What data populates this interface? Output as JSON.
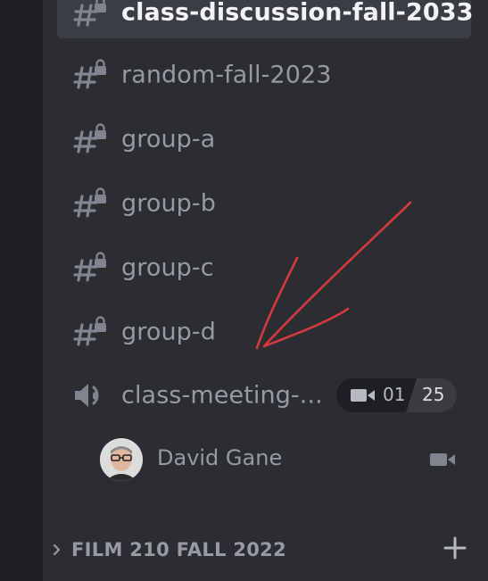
{
  "channels": [
    {
      "label": "class-discussion-fall-2033",
      "icon": "locked-text-channel-icon",
      "selected": true
    },
    {
      "label": "random-fall-2023",
      "icon": "locked-text-channel-icon",
      "selected": false
    },
    {
      "label": "group-a",
      "icon": "locked-text-channel-icon",
      "selected": false
    },
    {
      "label": "group-b",
      "icon": "locked-text-channel-icon",
      "selected": false
    },
    {
      "label": "group-c",
      "icon": "locked-text-channel-icon",
      "selected": false
    },
    {
      "label": "group-d",
      "icon": "locked-text-channel-icon",
      "selected": false
    }
  ],
  "voice_channel": {
    "label": "class-meeting-...",
    "icon": "voice-channel-icon",
    "user_count": "01",
    "user_limit": "25"
  },
  "voice_user": {
    "name": "David Gane",
    "status_icon": "video-camera-icon"
  },
  "category": {
    "label": "FILM 210 FALL 2022",
    "add_icon": "plus-icon"
  },
  "colors": {
    "rail_bg": "#1e1f22",
    "panel_bg": "#2b2d31",
    "selected_bg": "#3b3d44",
    "muted_text": "#949ba4",
    "selected_text": "#f2f3f5",
    "annotation": "#d23a3f"
  }
}
